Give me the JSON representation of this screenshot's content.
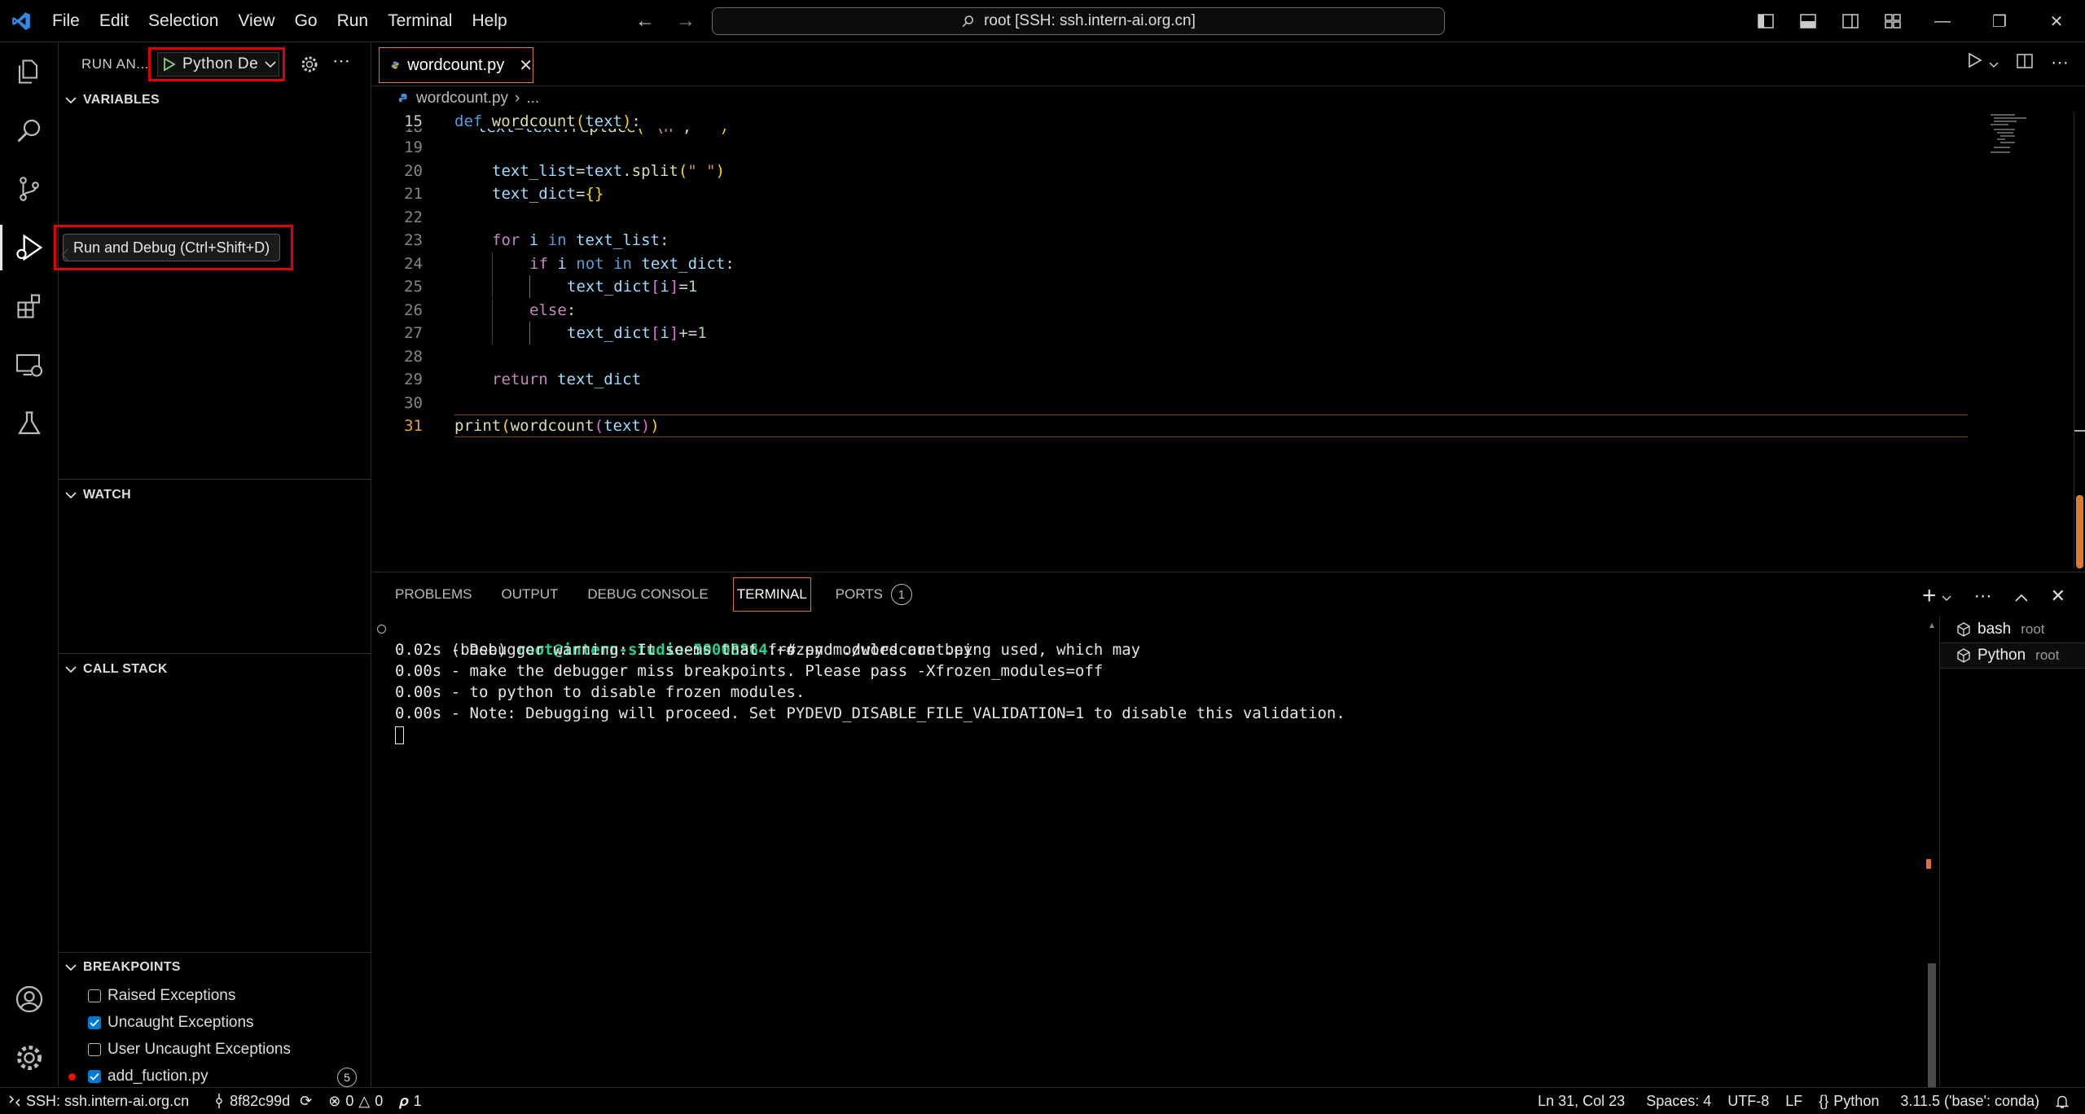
{
  "titlebar": {
    "menu": [
      "File",
      "Edit",
      "Selection",
      "View",
      "Go",
      "Run",
      "Terminal",
      "Help"
    ],
    "command_center": "root [SSH: ssh.intern-ai.org.cn]"
  },
  "activity": {
    "tooltip": "Run and Debug (Ctrl+Shift+D)"
  },
  "sidebar": {
    "title": "RUN AN...",
    "launch_config": "Python De",
    "sections": {
      "variables": "VARIABLES",
      "watch": "WATCH",
      "call_stack": "CALL STACK",
      "breakpoints": "BREAKPOINTS"
    },
    "breakpoints": [
      {
        "label": "Raised Exceptions",
        "checked": false
      },
      {
        "label": "Uncaught Exceptions",
        "checked": true
      },
      {
        "label": "User Uncaught Exceptions",
        "checked": false
      },
      {
        "label": "add_fuction.py",
        "checked": true,
        "count": "5"
      }
    ]
  },
  "editor": {
    "tab": "wordcount.py",
    "breadcrumb_file": "wordcount.py",
    "breadcrumb_rest": "...",
    "sticky_line_number": "15",
    "sticky_line_text": "def wordcount(text):",
    "line_numbers": [
      "18",
      "19",
      "20",
      "21",
      "22",
      "23",
      "24",
      "25",
      "26",
      "27",
      "28",
      "29",
      "30",
      "31"
    ],
    "lines": [
      "text=text.replace(\"\\n\",\" \")",
      "",
      "text_list=text.split(\" \")",
      "text_dict={}",
      "",
      "for i in text_list:",
      "if i not in text_dict:",
      "text_dict[i]=1",
      "else:",
      "text_dict[i]+=1",
      "",
      "return text_dict",
      "",
      "print(wordcount(text))"
    ]
  },
  "panel": {
    "tabs": [
      "PROBLEMS",
      "OUTPUT",
      "DEBUG CONSOLE",
      "TERMINAL",
      "PORTS"
    ],
    "ports_count": "1",
    "terminal": {
      "prompt_env": "(base) ",
      "prompt_user": "root@intern-studio-50008864",
      "prompt_path": ":~# ",
      "command": "pyd ./wordcount.py",
      "output": [
        "0.02s - Debugger warning: It seems that frozen modules are being used, which may",
        "0.00s - make the debugger miss breakpoints. Please pass -Xfrozen_modules=off",
        "0.00s - to python to disable frozen modules.",
        "0.00s - Note: Debugging will proceed. Set PYDEVD_DISABLE_FILE_VALIDATION=1 to disable this validation."
      ]
    },
    "terminal_list": [
      {
        "name": "bash",
        "sub": "root"
      },
      {
        "name": "Python",
        "sub": "root"
      }
    ]
  },
  "statusbar": {
    "remote": "SSH: ssh.intern-ai.org.cn",
    "branch": "8f82c99d",
    "errors": "0",
    "warnings": "0",
    "ports": "1",
    "position": "Ln 31, Col 23",
    "spaces": "Spaces: 4",
    "encoding": "UTF-8",
    "eol": "LF",
    "language": "Python",
    "interpreter": "3.11.5 ('base': conda)"
  },
  "colors": {
    "accent": "#d97b2c",
    "highlight_box": "#e00000",
    "vscode_blue": "#0078d4",
    "terminal_green": "#23d18b"
  }
}
